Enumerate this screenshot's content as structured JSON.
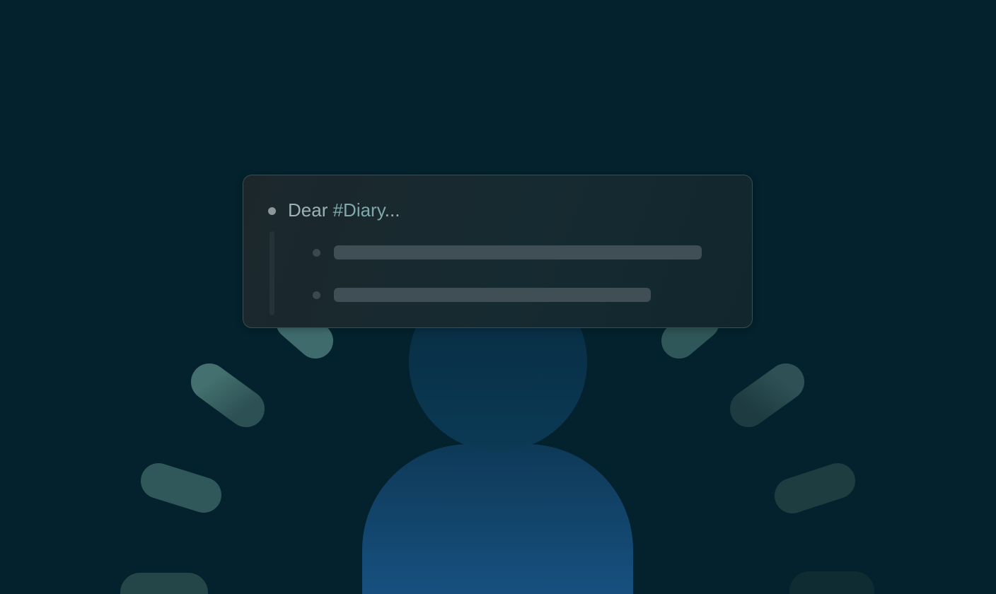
{
  "note_card": {
    "title_prefix": "Dear ",
    "tag": "#Diary",
    "title_suffix": "...",
    "children_count_visible": 2
  },
  "colors": {
    "background": "#03222d",
    "tag": "#7fa8ab",
    "title_text": "#9cb2b4",
    "figure": "#15497a",
    "rays": "#3e6a6d"
  },
  "icons": {
    "figure": "person-silhouette-icon",
    "rays": "radiating-light-rays-icon",
    "bullets": "bullet-dot-icon"
  }
}
